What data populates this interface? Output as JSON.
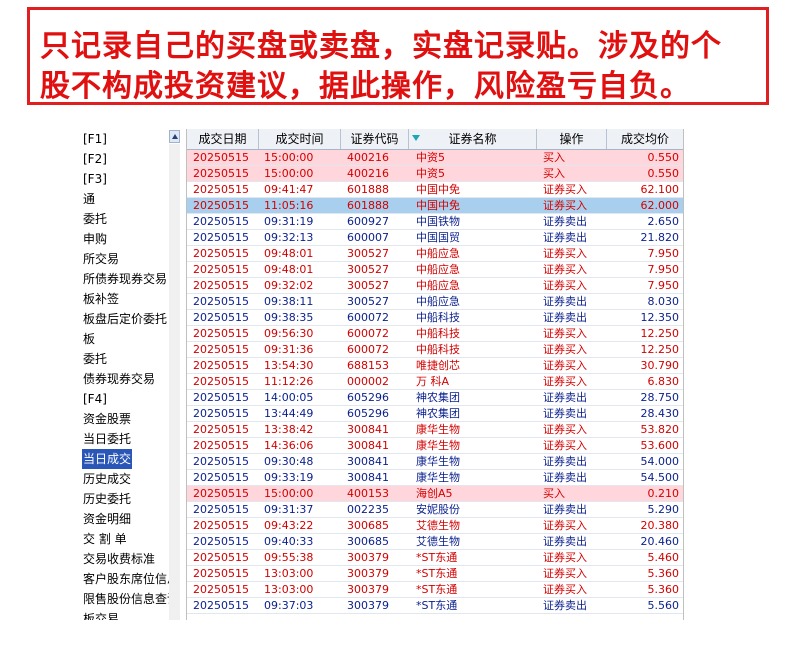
{
  "banner": {
    "line1": "只记录自己的买盘或卖盘，实盘记录贴。涉及的个",
    "line2": "股不构成投资建议，据此操作，风险盈亏自负。"
  },
  "tree": {
    "items": [
      "[F1]",
      "[F2]",
      "[F3]",
      "通",
      "委托",
      "申购",
      "所交易",
      "所债券现券交易",
      "板补签",
      "板盘后定价委托",
      "板",
      "委托",
      "债券现券交易",
      "[F4]",
      "资金股票",
      "当日委托",
      "当日成交",
      "历史成交",
      "历史委托",
      "资金明细",
      "交 割 单",
      "交易收费标准",
      "客户股东席位信息",
      "限售股份信息查询",
      "板交易"
    ],
    "selected_index": 16
  },
  "table": {
    "headers": [
      "成交日期",
      "成交时间",
      "证券代码",
      "证券名称",
      "操作",
      "成交均价"
    ],
    "sort_icon": "sort-down-icon",
    "rows": [
      {
        "date": "20250515",
        "time": "15:00:00",
        "code": "400216",
        "name": "中资5",
        "op": "买入",
        "price": "0.550",
        "style": "pink",
        "color": "buy"
      },
      {
        "date": "20250515",
        "time": "15:00:00",
        "code": "400216",
        "name": "中资5",
        "op": "买入",
        "price": "0.550",
        "style": "pink",
        "color": "buy"
      },
      {
        "date": "20250515",
        "time": "09:41:47",
        "code": "601888",
        "name": "中国中免",
        "op": "证券买入",
        "price": "62.100",
        "style": "",
        "color": "buy"
      },
      {
        "date": "20250515",
        "time": "11:05:16",
        "code": "601888",
        "name": "中国中免",
        "op": "证券买入",
        "price": "62.000",
        "style": "sel",
        "color": "buy"
      },
      {
        "date": "20250515",
        "time": "09:31:19",
        "code": "600927",
        "name": "中国铁物",
        "op": "证券卖出",
        "price": "2.650",
        "style": "",
        "color": "sell"
      },
      {
        "date": "20250515",
        "time": "09:32:13",
        "code": "600007",
        "name": "中国国贸",
        "op": "证券卖出",
        "price": "21.820",
        "style": "",
        "color": "sell"
      },
      {
        "date": "20250515",
        "time": "09:48:01",
        "code": "300527",
        "name": "中船应急",
        "op": "证券买入",
        "price": "7.950",
        "style": "",
        "color": "buy"
      },
      {
        "date": "20250515",
        "time": "09:48:01",
        "code": "300527",
        "name": "中船应急",
        "op": "证券买入",
        "price": "7.950",
        "style": "",
        "color": "buy"
      },
      {
        "date": "20250515",
        "time": "09:32:02",
        "code": "300527",
        "name": "中船应急",
        "op": "证券买入",
        "price": "7.950",
        "style": "",
        "color": "buy"
      },
      {
        "date": "20250515",
        "time": "09:38:11",
        "code": "300527",
        "name": "中船应急",
        "op": "证券卖出",
        "price": "8.030",
        "style": "",
        "color": "sell"
      },
      {
        "date": "20250515",
        "time": "09:38:35",
        "code": "600072",
        "name": "中船科技",
        "op": "证券卖出",
        "price": "12.350",
        "style": "",
        "color": "sell"
      },
      {
        "date": "20250515",
        "time": "09:56:30",
        "code": "600072",
        "name": "中船科技",
        "op": "证券买入",
        "price": "12.250",
        "style": "",
        "color": "buy"
      },
      {
        "date": "20250515",
        "time": "09:31:36",
        "code": "600072",
        "name": "中船科技",
        "op": "证券买入",
        "price": "12.250",
        "style": "",
        "color": "buy"
      },
      {
        "date": "20250515",
        "time": "13:54:30",
        "code": "688153",
        "name": "唯捷创芯",
        "op": "证券买入",
        "price": "30.790",
        "style": "",
        "color": "buy"
      },
      {
        "date": "20250515",
        "time": "11:12:26",
        "code": "000002",
        "name": "万 科A",
        "op": "证券买入",
        "price": "6.830",
        "style": "",
        "color": "buy"
      },
      {
        "date": "20250515",
        "time": "14:00:05",
        "code": "605296",
        "name": "神农集团",
        "op": "证券卖出",
        "price": "28.750",
        "style": "",
        "color": "sell"
      },
      {
        "date": "20250515",
        "time": "13:44:49",
        "code": "605296",
        "name": "神农集团",
        "op": "证券卖出",
        "price": "28.430",
        "style": "",
        "color": "sell"
      },
      {
        "date": "20250515",
        "time": "13:38:42",
        "code": "300841",
        "name": "康华生物",
        "op": "证券买入",
        "price": "53.820",
        "style": "",
        "color": "buy"
      },
      {
        "date": "20250515",
        "time": "14:36:06",
        "code": "300841",
        "name": "康华生物",
        "op": "证券买入",
        "price": "53.600",
        "style": "",
        "color": "buy"
      },
      {
        "date": "20250515",
        "time": "09:30:48",
        "code": "300841",
        "name": "康华生物",
        "op": "证券卖出",
        "price": "54.000",
        "style": "",
        "color": "sell"
      },
      {
        "date": "20250515",
        "time": "09:33:19",
        "code": "300841",
        "name": "康华生物",
        "op": "证券卖出",
        "price": "54.500",
        "style": "",
        "color": "sell"
      },
      {
        "date": "20250515",
        "time": "15:00:00",
        "code": "400153",
        "name": "海创A5",
        "op": "买入",
        "price": "0.210",
        "style": "pink",
        "color": "buy"
      },
      {
        "date": "20250515",
        "time": "09:31:37",
        "code": "002235",
        "name": "安妮股份",
        "op": "证券卖出",
        "price": "5.290",
        "style": "",
        "color": "sell"
      },
      {
        "date": "20250515",
        "time": "09:43:22",
        "code": "300685",
        "name": "艾德生物",
        "op": "证券买入",
        "price": "20.380",
        "style": "",
        "color": "buy"
      },
      {
        "date": "20250515",
        "time": "09:40:33",
        "code": "300685",
        "name": "艾德生物",
        "op": "证券卖出",
        "price": "20.460",
        "style": "",
        "color": "sell"
      },
      {
        "date": "20250515",
        "time": "09:55:38",
        "code": "300379",
        "name": "*ST东通",
        "op": "证券买入",
        "price": "5.460",
        "style": "",
        "color": "buy"
      },
      {
        "date": "20250515",
        "time": "13:03:00",
        "code": "300379",
        "name": "*ST东通",
        "op": "证券买入",
        "price": "5.360",
        "style": "",
        "color": "buy"
      },
      {
        "date": "20250515",
        "time": "13:03:00",
        "code": "300379",
        "name": "*ST东通",
        "op": "证券买入",
        "price": "5.360",
        "style": "",
        "color": "buy"
      },
      {
        "date": "20250515",
        "time": "09:37:03",
        "code": "300379",
        "name": "*ST东通",
        "op": "证券卖出",
        "price": "5.560",
        "style": "",
        "color": "sell"
      }
    ]
  },
  "colors": {
    "banner_red": "#e01010",
    "buy_text": "#d40000",
    "sell_text": "#0a1f8c",
    "pink_row": "#ffd6dc",
    "selected_row": "#a8d0ee",
    "tree_selected": "#2a56b8"
  }
}
